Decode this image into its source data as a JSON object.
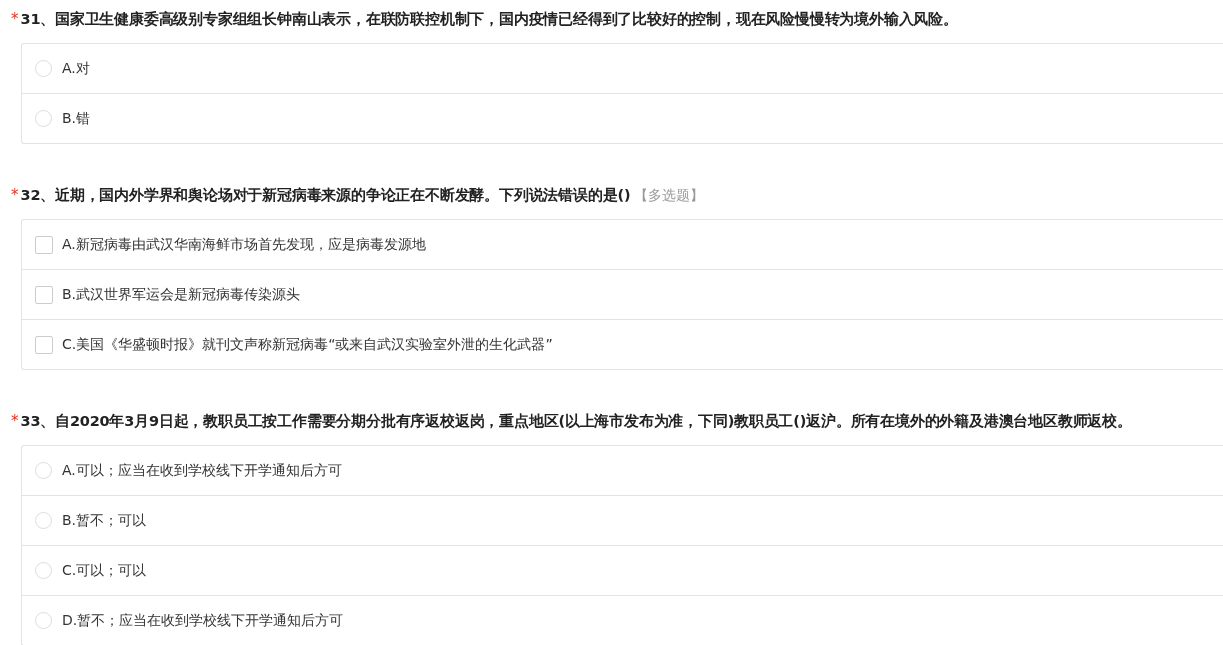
{
  "questions": [
    {
      "number": "31",
      "required_mark": "*",
      "title": "、国家卫生健康委高级别专家组组长钟南山表示，在联防联控机制下，国内疫情已经得到了比较好的控制，现在风险慢慢转为境外输入风险。",
      "kind": "radio",
      "options": [
        {
          "label": "A.对",
          "selected": false
        },
        {
          "label": "B.错",
          "selected": false
        }
      ]
    },
    {
      "number": "32",
      "required_mark": "*",
      "title": "、近期，国内外学界和舆论场对于新冠病毒来源的争论正在不断发酵。下列说法错误的是()",
      "tag": "【多选题】",
      "kind": "checkbox",
      "options": [
        {
          "label": "A.新冠病毒由武汉华南海鲜市场首先发现，应是病毒发源地",
          "selected": false
        },
        {
          "label": "B.武汉世界军运会是新冠病毒传染源头",
          "selected": false
        },
        {
          "label": "C.美国《华盛顿时报》就刊文声称新冠病毒“或来自武汉实验室外泄的生化武器”",
          "selected": false
        }
      ]
    },
    {
      "number": "33",
      "required_mark": "*",
      "title": "、自2020年3月9日起，教职员工按工作需要分期分批有序返校返岗，重点地区(以上海市发布为准，下同)教职员工()返沪。所有在境外的外籍及港澳台地区教师返校。",
      "kind": "radio",
      "options": [
        {
          "label": "A.可以；应当在收到学校线下开学通知后方可",
          "selected": false
        },
        {
          "label": "B.暂不；可以",
          "selected": false
        },
        {
          "label": "C.可以；可以",
          "selected": false
        },
        {
          "label": "D.暂不；应当在收到学校线下开学通知后方可",
          "selected": false
        }
      ]
    }
  ]
}
